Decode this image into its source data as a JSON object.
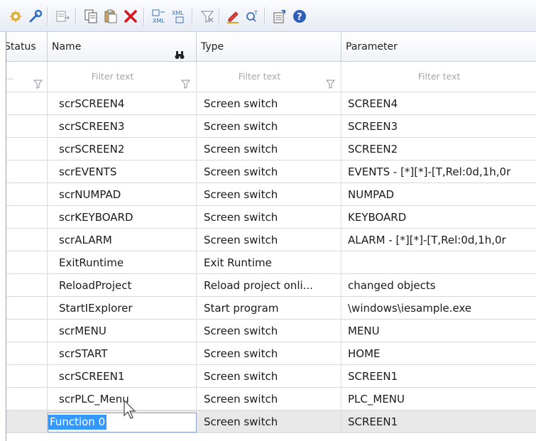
{
  "toolbar": {
    "icons": [
      "add-function-icon",
      "wrench-icon",
      "move-icon",
      "copy-icon",
      "paste-icon",
      "delete-icon",
      "export-xml-icon",
      "import-xml-icon",
      "filter-clear-icon",
      "edit-icon",
      "query-icon",
      "properties-icon",
      "help-icon"
    ]
  },
  "columns": {
    "status": "Status",
    "name": "Name",
    "type": "Type",
    "parameter": "Parameter"
  },
  "filters": {
    "status_placeholder": "F...",
    "name_placeholder": "Filter text",
    "type_placeholder": "Filter text",
    "parameter_placeholder": "Filter text"
  },
  "rows": [
    {
      "name": "scrSCREEN4",
      "type": "Screen switch",
      "parameter": "SCREEN4"
    },
    {
      "name": "scrSCREEN3",
      "type": "Screen switch",
      "parameter": "SCREEN3"
    },
    {
      "name": "scrSCREEN2",
      "type": "Screen switch",
      "parameter": "SCREEN2"
    },
    {
      "name": "scrEVENTS",
      "type": "Screen switch",
      "parameter": "EVENTS - [*][*]-[T,Rel:0d,1h,0r"
    },
    {
      "name": "scrNUMPAD",
      "type": "Screen switch",
      "parameter": "NUMPAD"
    },
    {
      "name": "scrKEYBOARD",
      "type": "Screen switch",
      "parameter": "KEYBOARD"
    },
    {
      "name": "scrALARM",
      "type": "Screen switch",
      "parameter": "ALARM - [*][*]-[T,Rel:0d,1h,0r"
    },
    {
      "name": "ExitRuntime",
      "type": "Exit Runtime",
      "parameter": ""
    },
    {
      "name": "ReloadProject",
      "type": "Reload project onli...",
      "parameter": "changed objects"
    },
    {
      "name": "StartIExplorer",
      "type": "Start program",
      "parameter": "\\windows\\iesample.exe"
    },
    {
      "name": "scrMENU",
      "type": "Screen switch",
      "parameter": "MENU"
    },
    {
      "name": "scrSTART",
      "type": "Screen switch",
      "parameter": "HOME"
    },
    {
      "name": "scrSCREEN1",
      "type": "Screen switch",
      "parameter": "SCREEN1"
    },
    {
      "name": "scrPLC_Menu",
      "type": "Screen switch",
      "parameter": "PLC_MENU"
    },
    {
      "name": "Function 0",
      "type": "Screen switch",
      "parameter": "SCREEN1"
    }
  ]
}
